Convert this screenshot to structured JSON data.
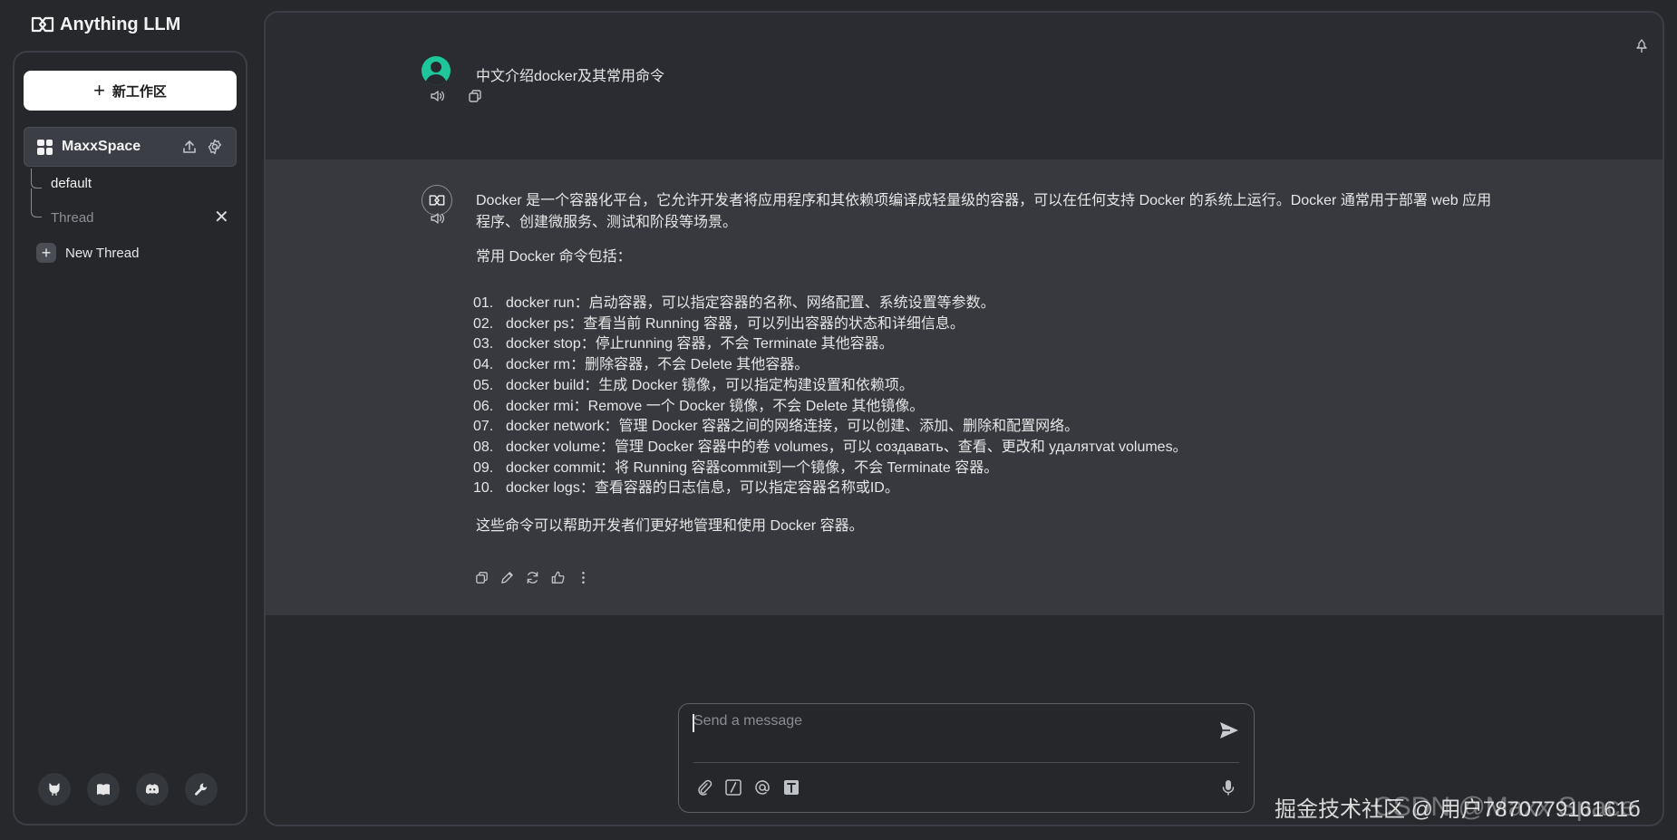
{
  "app": {
    "name": "Anything LLM"
  },
  "sidebar": {
    "new_workspace_label": "新工作区",
    "workspace": {
      "name": "MaxxSpace"
    },
    "threads": [
      {
        "label": "default"
      },
      {
        "label": "Thread"
      }
    ],
    "new_thread_label": "New Thread",
    "footer_icons": [
      "github-icon",
      "book-icon",
      "discord-icon",
      "wrench-icon"
    ]
  },
  "chat": {
    "user_message": "中文介绍docker及其常用命令",
    "bot_intro": "Docker 是一个容器化平台，它允许开发者将应用程序和其依赖项编译成轻量级的容器，可以在任何支持 Docker 的系统上运行。Docker 通常用于部署 web 应用程序、创建微服务、测试和阶段等场景。",
    "bot_subtitle": "常用 Docker 命令包括：",
    "commands": [
      {
        "num": "01.",
        "text": "docker run：启动容器，可以指定容器的名称、网络配置、系统设置等参数。"
      },
      {
        "num": "02.",
        "text": "docker ps：查看当前 Running 容器，可以列出容器的状态和详细信息。"
      },
      {
        "num": "03.",
        "text": "docker stop：停止running 容器，不会 Terminate 其他容器。"
      },
      {
        "num": "04.",
        "text": "docker rm：删除容器，不会 Delete 其他容器。"
      },
      {
        "num": "05.",
        "text": "docker build：生成 Docker 镜像，可以指定构建设置和依赖项。"
      },
      {
        "num": "06.",
        "text": "docker rmi：Remove 一个 Docker 镜像，不会 Delete 其他镜像。"
      },
      {
        "num": "07.",
        "text": "docker network：管理 Docker 容器之间的网络连接，可以创建、添加、删除和配置网络。"
      },
      {
        "num": "08.",
        "text": "docker volume：管理 Docker 容器中的卷 volumes，可以 создавать、查看、更改和 удалятvat volumes。"
      },
      {
        "num": "09.",
        "text": "docker commit：将 Running 容器commit到一个镜像，不会 Terminate 容器。"
      },
      {
        "num": "10.",
        "text": "docker logs：查看容器的日志信息，可以指定容器名称或ID。"
      }
    ],
    "bot_conclusion": "这些命令可以帮助开发者们更好地管理和使用 Docker 容器。"
  },
  "composer": {
    "placeholder": "Send a message"
  },
  "watermark": {
    "line1": "掘金技术社区 @ 用户787077916161б",
    "line2": "CSDN @Maxx Space"
  },
  "colors": {
    "accent_user_avatar": "#1ec79b",
    "background": "#26282c",
    "bot_row": "#37393f"
  }
}
